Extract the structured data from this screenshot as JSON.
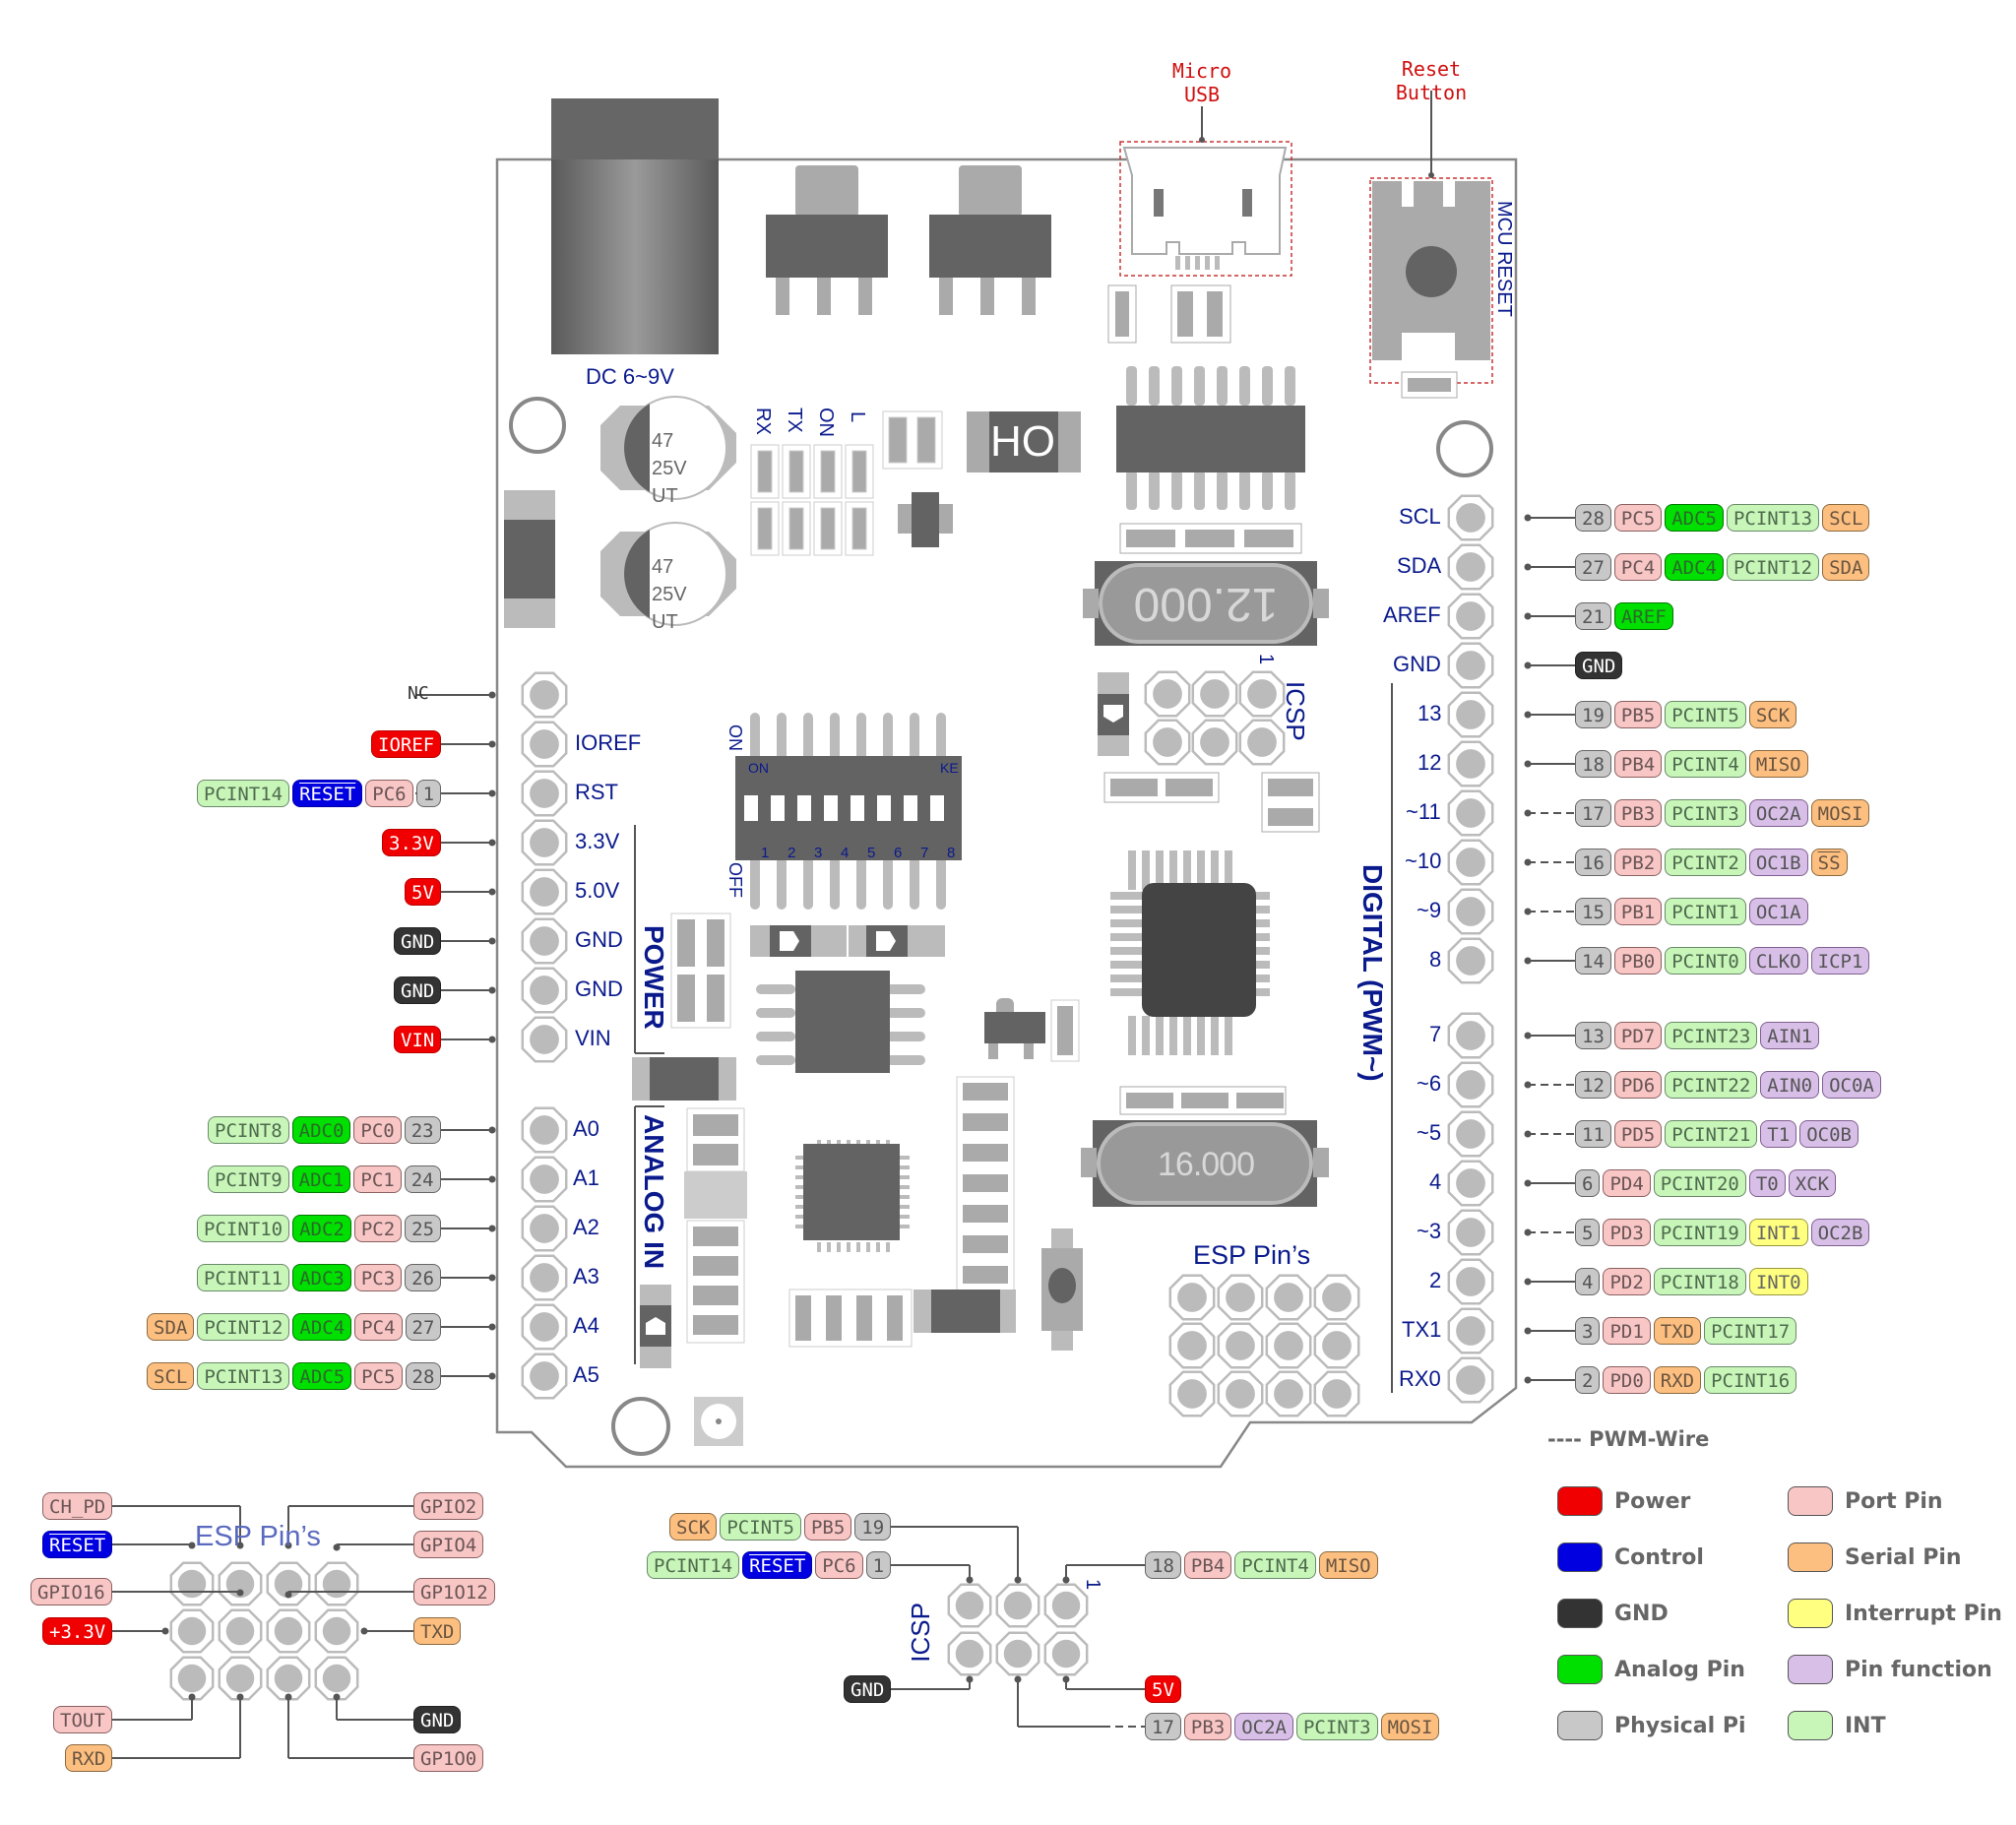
{
  "colors": {
    "power": "#f00000",
    "control": "#0000e0",
    "gnd": "#333333",
    "analog": "#00e000",
    "physical": "#c8c8c8",
    "port": "#f9c6c6",
    "serial": "#fdbf80",
    "interrupt": "#ffff80",
    "function": "#d8bfe8",
    "pcint": "#c8f5b8",
    "board_label": "#0a1a8c",
    "callout": "#d01010"
  },
  "callouts": {
    "micro_usb": "Micro\nUSB",
    "reset_button": "Reset\nButton"
  },
  "board": {
    "dc_jack": "DC 6~9V",
    "cap1": [
      "47",
      "25V",
      "UT"
    ],
    "cap2": [
      "47",
      "25V",
      "UT"
    ],
    "leds": [
      "RX",
      "TX",
      "ON",
      "L"
    ],
    "ho_chip": "HO",
    "crystal_top": "12.000",
    "crystal_bottom": "16.000",
    "mcu_reset": "MCU RESET",
    "icsp": "ICSP",
    "icsp_pin1": "1",
    "dip_on": "ON",
    "dip_off": "OFF",
    "dip_on_inner": "ON",
    "dip_ke": "KE",
    "dip_numbers": [
      "1",
      "2",
      "3",
      "4",
      "5",
      "6",
      "7",
      "8"
    ],
    "power_section": "POWER",
    "analog_section": "ANALOG IN",
    "digital_section": "DIGITAL (PWM~)",
    "esp_pins": "ESP Pin’s"
  },
  "left_header": [
    {
      "label": "",
      "ext": "NC",
      "tags": []
    },
    {
      "label": "IOREF",
      "tags": [
        {
          "t": "IOREF",
          "c": "power"
        }
      ]
    },
    {
      "label": "RST",
      "tags": [
        {
          "t": "PCINT14",
          "c": "pcint"
        },
        {
          "t": "RESET",
          "c": "control"
        },
        {
          "t": "PC6",
          "c": "port"
        },
        {
          "t": "1",
          "c": "phys"
        }
      ]
    },
    {
      "label": "3.3V",
      "tags": [
        {
          "t": "3.3V",
          "c": "power"
        }
      ]
    },
    {
      "label": "5.0V",
      "tags": [
        {
          "t": "5V",
          "c": "power"
        }
      ]
    },
    {
      "label": "GND",
      "tags": [
        {
          "t": "GND",
          "c": "gnd"
        }
      ]
    },
    {
      "label": "GND",
      "tags": [
        {
          "t": "GND",
          "c": "gnd"
        }
      ]
    },
    {
      "label": "VIN",
      "tags": [
        {
          "t": "VIN",
          "c": "power"
        }
      ]
    }
  ],
  "analog_header": [
    {
      "label": "A0",
      "tags": [
        {
          "t": "PCINT8",
          "c": "pcint"
        },
        {
          "t": "ADC0",
          "c": "analog"
        },
        {
          "t": "PC0",
          "c": "port"
        },
        {
          "t": "23",
          "c": "phys"
        }
      ]
    },
    {
      "label": "A1",
      "tags": [
        {
          "t": "PCINT9",
          "c": "pcint"
        },
        {
          "t": "ADC1",
          "c": "analog"
        },
        {
          "t": "PC1",
          "c": "port"
        },
        {
          "t": "24",
          "c": "phys"
        }
      ]
    },
    {
      "label": "A2",
      "tags": [
        {
          "t": "PCINT10",
          "c": "pcint"
        },
        {
          "t": "ADC2",
          "c": "analog"
        },
        {
          "t": "PC2",
          "c": "port"
        },
        {
          "t": "25",
          "c": "phys"
        }
      ]
    },
    {
      "label": "A3",
      "tags": [
        {
          "t": "PCINT11",
          "c": "pcint"
        },
        {
          "t": "ADC3",
          "c": "analog"
        },
        {
          "t": "PC3",
          "c": "port"
        },
        {
          "t": "26",
          "c": "phys"
        }
      ]
    },
    {
      "label": "A4",
      "tags": [
        {
          "t": "SDA",
          "c": "serial"
        },
        {
          "t": "PCINT12",
          "c": "pcint"
        },
        {
          "t": "ADC4",
          "c": "analog"
        },
        {
          "t": "PC4",
          "c": "port"
        },
        {
          "t": "27",
          "c": "phys"
        }
      ]
    },
    {
      "label": "A5",
      "tags": [
        {
          "t": "SCL",
          "c": "serial"
        },
        {
          "t": "PCINT13",
          "c": "pcint"
        },
        {
          "t": "ADC5",
          "c": "analog"
        },
        {
          "t": "PC5",
          "c": "port"
        },
        {
          "t": "28",
          "c": "phys"
        }
      ]
    }
  ],
  "right_header_top": [
    {
      "label": "SCL",
      "pwm": false,
      "tags": [
        {
          "t": "28",
          "c": "phys"
        },
        {
          "t": "PC5",
          "c": "port"
        },
        {
          "t": "ADC5",
          "c": "analog"
        },
        {
          "t": "PCINT13",
          "c": "pcint"
        },
        {
          "t": "SCL",
          "c": "serial"
        }
      ]
    },
    {
      "label": "SDA",
      "pwm": false,
      "tags": [
        {
          "t": "27",
          "c": "phys"
        },
        {
          "t": "PC4",
          "c": "port"
        },
        {
          "t": "ADC4",
          "c": "analog"
        },
        {
          "t": "PCINT12",
          "c": "pcint"
        },
        {
          "t": "SDA",
          "c": "serial"
        }
      ]
    },
    {
      "label": "AREF",
      "pwm": false,
      "tags": [
        {
          "t": "21",
          "c": "phys"
        },
        {
          "t": "AREF",
          "c": "analog"
        }
      ]
    },
    {
      "label": "GND",
      "pwm": false,
      "tags": [
        {
          "t": "GND",
          "c": "gnd"
        }
      ]
    },
    {
      "label": "13",
      "pwm": false,
      "tags": [
        {
          "t": "19",
          "c": "phys"
        },
        {
          "t": "PB5",
          "c": "port"
        },
        {
          "t": "PCINT5",
          "c": "pcint"
        },
        {
          "t": "SCK",
          "c": "serial"
        }
      ]
    },
    {
      "label": "12",
      "pwm": false,
      "tags": [
        {
          "t": "18",
          "c": "phys"
        },
        {
          "t": "PB4",
          "c": "port"
        },
        {
          "t": "PCINT4",
          "c": "pcint"
        },
        {
          "t": "MISO",
          "c": "serial"
        }
      ]
    },
    {
      "label": "~11",
      "pwm": true,
      "tags": [
        {
          "t": "17",
          "c": "phys"
        },
        {
          "t": "PB3",
          "c": "port"
        },
        {
          "t": "PCINT3",
          "c": "pcint"
        },
        {
          "t": "OC2A",
          "c": "func"
        },
        {
          "t": "MOSI",
          "c": "serial"
        }
      ]
    },
    {
      "label": "~10",
      "pwm": true,
      "tags": [
        {
          "t": "16",
          "c": "phys"
        },
        {
          "t": "PB2",
          "c": "port"
        },
        {
          "t": "PCINT2",
          "c": "pcint"
        },
        {
          "t": "OC1B",
          "c": "func"
        },
        {
          "t": "SS",
          "c": "serial",
          "over": true
        }
      ]
    },
    {
      "label": "~9",
      "pwm": true,
      "tags": [
        {
          "t": "15",
          "c": "phys"
        },
        {
          "t": "PB1",
          "c": "port"
        },
        {
          "t": "PCINT1",
          "c": "pcint"
        },
        {
          "t": "OC1A",
          "c": "func"
        }
      ]
    },
    {
      "label": "8",
      "pwm": false,
      "tags": [
        {
          "t": "14",
          "c": "phys"
        },
        {
          "t": "PB0",
          "c": "port"
        },
        {
          "t": "PCINT0",
          "c": "pcint"
        },
        {
          "t": "CLKO",
          "c": "func"
        },
        {
          "t": "ICP1",
          "c": "func"
        }
      ]
    }
  ],
  "right_header_bottom": [
    {
      "label": "7",
      "pwm": false,
      "tags": [
        {
          "t": "13",
          "c": "phys"
        },
        {
          "t": "PD7",
          "c": "port"
        },
        {
          "t": "PCINT23",
          "c": "pcint"
        },
        {
          "t": "AIN1",
          "c": "func"
        }
      ]
    },
    {
      "label": "~6",
      "pwm": true,
      "tags": [
        {
          "t": "12",
          "c": "phys"
        },
        {
          "t": "PD6",
          "c": "port"
        },
        {
          "t": "PCINT22",
          "c": "pcint"
        },
        {
          "t": "AIN0",
          "c": "func"
        },
        {
          "t": "OC0A",
          "c": "func"
        }
      ]
    },
    {
      "label": "~5",
      "pwm": true,
      "tags": [
        {
          "t": "11",
          "c": "phys"
        },
        {
          "t": "PD5",
          "c": "port"
        },
        {
          "t": "PCINT21",
          "c": "pcint"
        },
        {
          "t": "T1",
          "c": "func"
        },
        {
          "t": "OC0B",
          "c": "func"
        }
      ]
    },
    {
      "label": "4",
      "pwm": false,
      "tags": [
        {
          "t": "6",
          "c": "phys"
        },
        {
          "t": "PD4",
          "c": "port"
        },
        {
          "t": "PCINT20",
          "c": "pcint"
        },
        {
          "t": "T0",
          "c": "func"
        },
        {
          "t": "XCK",
          "c": "func"
        }
      ]
    },
    {
      "label": "~3",
      "pwm": true,
      "tags": [
        {
          "t": "5",
          "c": "phys"
        },
        {
          "t": "PD3",
          "c": "port"
        },
        {
          "t": "PCINT19",
          "c": "pcint"
        },
        {
          "t": "INT1",
          "c": "int"
        },
        {
          "t": "OC2B",
          "c": "func"
        }
      ]
    },
    {
      "label": "2",
      "pwm": false,
      "tags": [
        {
          "t": "4",
          "c": "phys"
        },
        {
          "t": "PD2",
          "c": "port"
        },
        {
          "t": "PCINT18",
          "c": "pcint"
        },
        {
          "t": "INT0",
          "c": "int"
        }
      ]
    },
    {
      "label": "TX1",
      "pwm": false,
      "tags": [
        {
          "t": "3",
          "c": "phys"
        },
        {
          "t": "PD1",
          "c": "port"
        },
        {
          "t": "TXD",
          "c": "serial"
        },
        {
          "t": "PCINT17",
          "c": "pcint"
        }
      ]
    },
    {
      "label": "RX0",
      "pwm": false,
      "tags": [
        {
          "t": "2",
          "c": "phys"
        },
        {
          "t": "PD0",
          "c": "port"
        },
        {
          "t": "RXD",
          "c": "serial"
        },
        {
          "t": "PCINT16",
          "c": "pcint"
        }
      ]
    }
  ],
  "esp_diagram": {
    "title": "ESP Pin’s",
    "left": [
      {
        "t": "CH_PD",
        "c": "port"
      },
      {
        "t": "RESET",
        "c": "control"
      },
      {
        "t": "GPIO16",
        "c": "port"
      },
      {
        "t": "+3.3V",
        "c": "power"
      },
      {
        "t": "TOUT",
        "c": "port"
      },
      {
        "t": "RXD",
        "c": "serial"
      }
    ],
    "right": [
      {
        "t": "GPIO2",
        "c": "port"
      },
      {
        "t": "GPIO4",
        "c": "port"
      },
      {
        "t": "GP1O12",
        "c": "port"
      },
      {
        "t": "TXD",
        "c": "serial"
      },
      {
        "t": "GND",
        "c": "gnd"
      },
      {
        "t": "GP1O0",
        "c": "port"
      }
    ]
  },
  "icsp_diagram": {
    "title": "ICSP",
    "pin1": "1",
    "top_left_1": [
      {
        "t": "SCK",
        "c": "serial"
      },
      {
        "t": "PCINT5",
        "c": "pcint"
      },
      {
        "t": "PB5",
        "c": "port"
      },
      {
        "t": "19",
        "c": "phys"
      }
    ],
    "top_left_2": [
      {
        "t": "PCINT14",
        "c": "pcint"
      },
      {
        "t": "RESET",
        "c": "control"
      },
      {
        "t": "PC6",
        "c": "port"
      },
      {
        "t": "1",
        "c": "phys"
      }
    ],
    "top_right": [
      {
        "t": "18",
        "c": "phys"
      },
      {
        "t": "PB4",
        "c": "port"
      },
      {
        "t": "PCINT4",
        "c": "pcint"
      },
      {
        "t": "MISO",
        "c": "serial"
      }
    ],
    "bottom_left": [
      {
        "t": "GND",
        "c": "gnd"
      }
    ],
    "bottom_right_1": [
      {
        "t": "5V",
        "c": "power"
      }
    ],
    "bottom_right_2": [
      {
        "t": "17",
        "c": "phys"
      },
      {
        "t": "PB3",
        "c": "port"
      },
      {
        "t": "OC2A",
        "c": "func"
      },
      {
        "t": "PCINT3",
        "c": "pcint"
      },
      {
        "t": "MOSI",
        "c": "serial"
      }
    ]
  },
  "legend": {
    "pwm_wire": "---- PWM-Wire",
    "items": [
      {
        "label": "Power",
        "c": "power"
      },
      {
        "label": "Control",
        "c": "control"
      },
      {
        "label": "GND",
        "c": "gnd"
      },
      {
        "label": "Analog Pin",
        "c": "analog"
      },
      {
        "label": "Physical Pi",
        "c": "phys"
      },
      {
        "label": "Port Pin",
        "c": "port"
      },
      {
        "label": "Serial Pin",
        "c": "serial"
      },
      {
        "label": "Interrupt Pin",
        "c": "int"
      },
      {
        "label": "Pin function",
        "c": "func"
      },
      {
        "label": "INT",
        "c": "pcint"
      }
    ]
  }
}
